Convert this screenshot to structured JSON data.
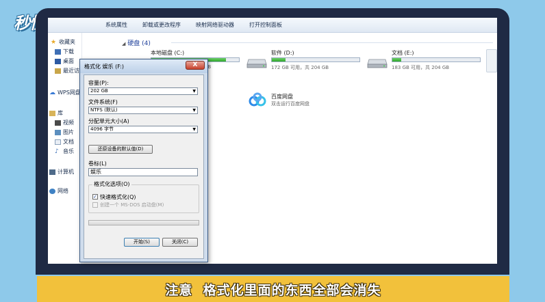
{
  "watermark": {
    "logo_text": "秒懂视频"
  },
  "toolbar": {
    "items": [
      "系统属性",
      "卸载或更改程序",
      "映射网络驱动器",
      "打开控制面板"
    ]
  },
  "navpane": {
    "favorites": "收藏夹",
    "downloads": "下载",
    "desktop": "桌面",
    "recent": "最近访",
    "wps": "WPS网盘",
    "library": "库",
    "videos": "视频",
    "pictures": "图片",
    "documents": "文档",
    "music": "音乐",
    "computer": "计算机",
    "network": "网络"
  },
  "content": {
    "hard_disks_title": "硬盘 (4)",
    "drives": [
      {
        "name": "本地磁盘 (C:)",
        "free_text": "GB",
        "fill": 0.85
      },
      {
        "name": "软件 (D:)",
        "free_text": "172 GB 可用，共 204 GB",
        "fill": 0.16
      },
      {
        "name": "文档 (E:)",
        "free_text": "183 GB 可用，共 204 GB",
        "fill": 0.1
      }
    ],
    "baidu": {
      "name": "百度网盘",
      "desc": "双击运行百度网盘"
    }
  },
  "dialog": {
    "title": "格式化 娱乐 (F:)",
    "close_label": "X",
    "capacity_label": "容量(P):",
    "capacity_value": "202 GB",
    "filesystem_label": "文件系统(F)",
    "filesystem_value": "NTFS (默认)",
    "allocation_label": "分配单元大小(A)",
    "allocation_value": "4096 字节",
    "restore_button": "还原设备的默认值(D)",
    "volume_label": "卷标(L)",
    "volume_value": "娱乐",
    "options_label": "格式化选项(O)",
    "quick_format_label": "快速格式化(Q)",
    "quick_format_checked": true,
    "msdos_label": "创建一个 MS-DOS 启动盘(M)",
    "start_button": "开始(S)",
    "close_button": "关闭(C)"
  },
  "caption": {
    "text": "注意  格式化里面的东西全部会消失"
  }
}
